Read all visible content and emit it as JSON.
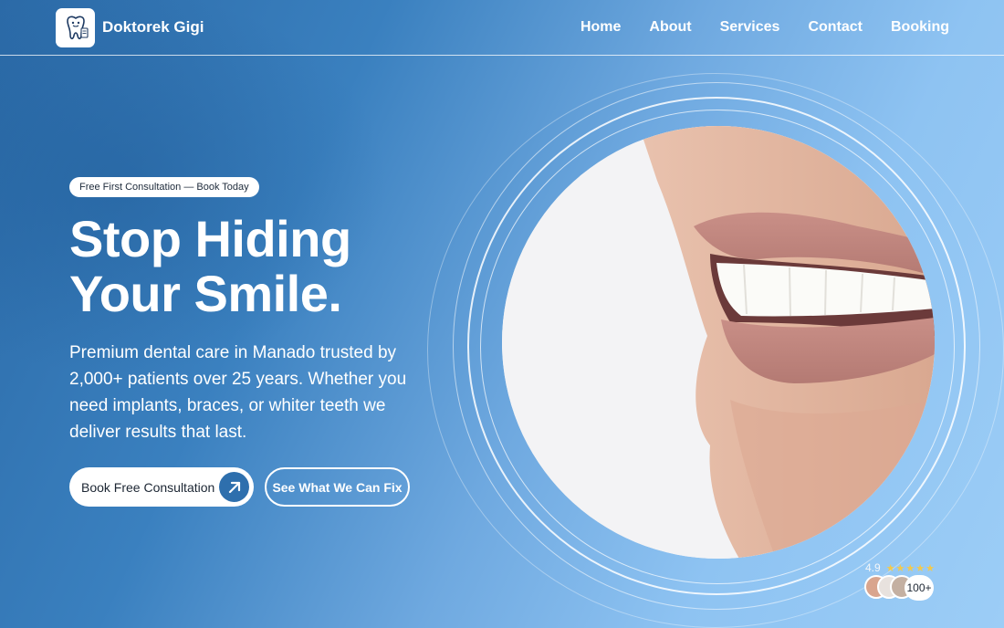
{
  "brand": {
    "name": "Doktorek Gigi",
    "logo_icon": "tooth-doctor-icon"
  },
  "nav": {
    "items": [
      "Home",
      "About",
      "Services",
      "Contact",
      "Booking"
    ]
  },
  "hero": {
    "badge": "Free First Consultation — Book Today",
    "headline_line1": "Stop Hiding",
    "headline_line2": "Your Smile.",
    "description": "Premium dental care in Manado trusted by 2,000+ patients over 25 years. Whether you need implants, braces, or whiter teeth  we deliver results that last.",
    "primary_cta": "Book Free Consultation",
    "primary_cta_icon": "arrow-up-right-icon",
    "secondary_cta": "See What We Can Fix"
  },
  "rating": {
    "score": "4.9",
    "stars": 5,
    "count_label": "100+"
  },
  "colors": {
    "accent": "#2e6fad",
    "background_start": "#2b6aa7",
    "background_end": "#9ccdf6",
    "star": "#f2c94c"
  }
}
